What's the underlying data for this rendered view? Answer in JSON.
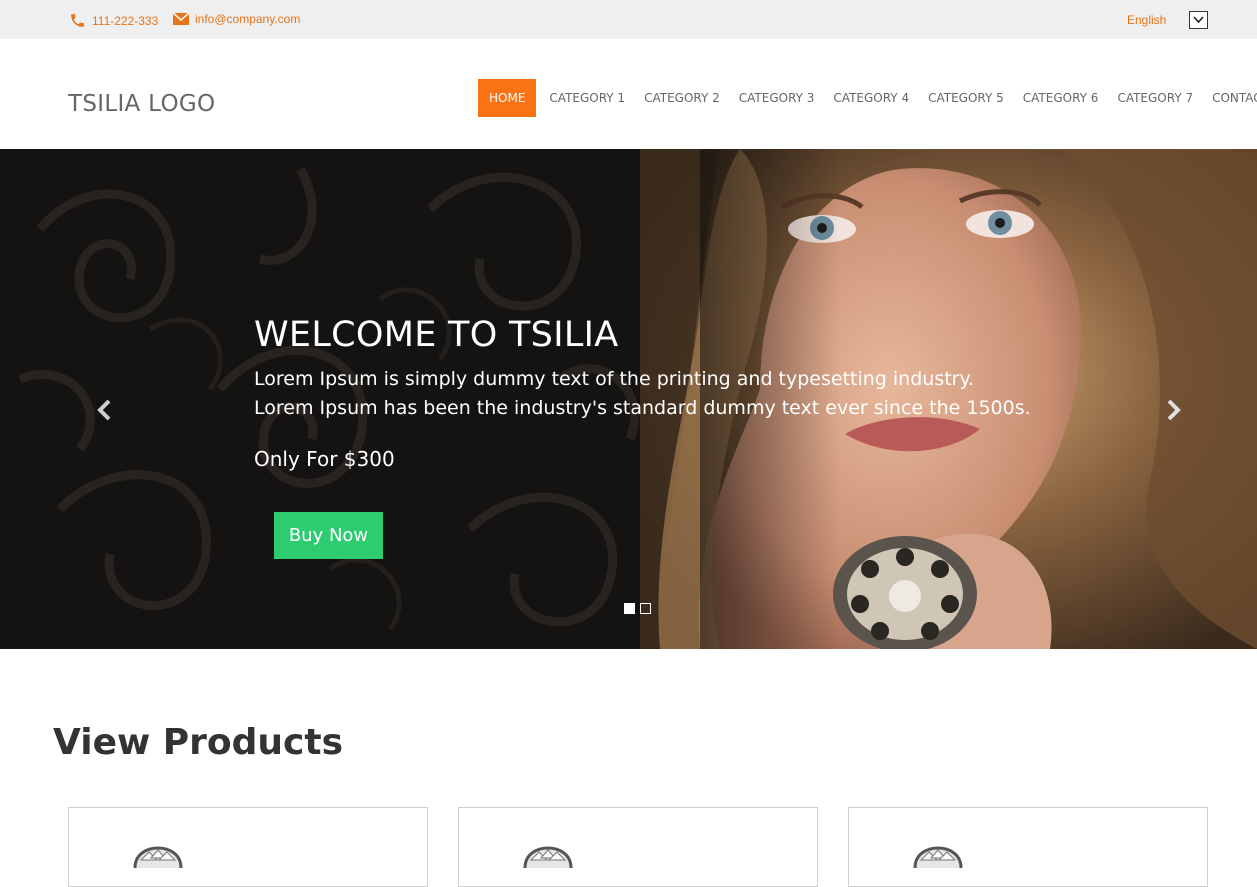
{
  "topbar": {
    "phone": "111-222-333",
    "email": "info@company.com",
    "language": "English",
    "phone_icon": "phone-icon",
    "mail_icon": "mail-icon",
    "accent_color": "#e8731a"
  },
  "header": {
    "logo": "TSILIA LOGO",
    "nav": [
      {
        "label": "HOME",
        "active": true
      },
      {
        "label": "CATEGORY 1"
      },
      {
        "label": "CATEGORY 2"
      },
      {
        "label": "CATEGORY 3"
      },
      {
        "label": "CATEGORY 4"
      },
      {
        "label": "CATEGORY 5"
      },
      {
        "label": "CATEGORY 6"
      },
      {
        "label": "CATEGORY 7"
      },
      {
        "label": "CONTACT"
      }
    ],
    "active_color": "#f97315"
  },
  "hero": {
    "title": "WELCOME TO TSILIA",
    "line1": "Lorem Ipsum is simply dummy text of the printing and typesetting industry.",
    "line2": "Lorem Ipsum has been the industry's standard dummy text ever since the 1500s.",
    "price": "Only For $300",
    "button": "Buy Now",
    "button_color": "#2ecc71",
    "slides_total": 2,
    "active_slide": 1
  },
  "products": {
    "title": "View Products",
    "cards": [
      {
        "image": "diamond-ring"
      },
      {
        "image": "diamond-ring"
      },
      {
        "image": "diamond-ring"
      }
    ]
  }
}
